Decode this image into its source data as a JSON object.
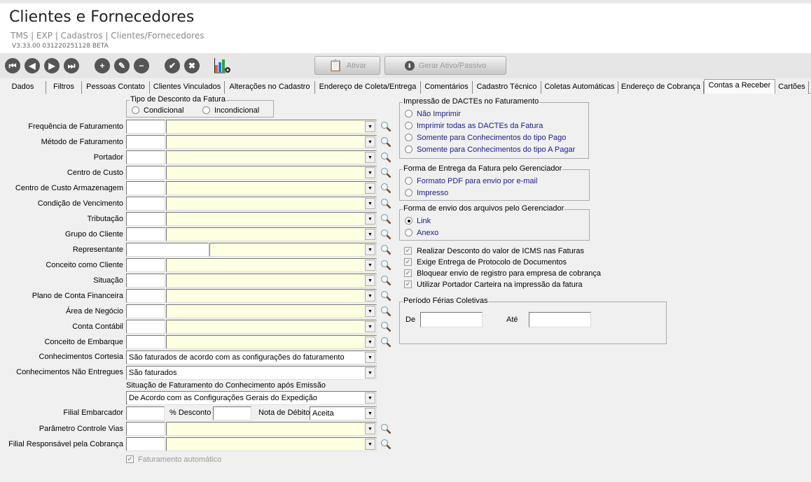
{
  "header": {
    "title": "Clientes e Fornecedores",
    "breadcrumb": "TMS | EXP | Cadastros | Clientes/Fornecedores",
    "version": "V3.33.00 031220251128 BETA"
  },
  "toolbar": {
    "icons": [
      "first-icon",
      "previous-icon",
      "next-icon",
      "last-icon",
      "add-icon",
      "edit-icon",
      "remove-icon",
      "confirm-icon",
      "cancel-icon",
      "chart-settings-icon"
    ],
    "ativar": "Ativar",
    "gerar": "Gerar Ativo/Passivo"
  },
  "tabs": [
    "Dados",
    "Filtros",
    "Pessoas Contato",
    "Clientes Vinculados",
    "Alterações no Cadastro",
    "Endereço de Coleta/Entrega",
    "Comentários",
    "Cadastro Técnico",
    "Coletas Automáticas",
    "Endereço de Cobrança",
    "Contas a Receber",
    "Cartões"
  ],
  "active_tab": "Contas a Receber",
  "desconto": {
    "legend": "Tipo de Desconto da Fatura",
    "options": [
      "Condicional",
      "Incondicional"
    ]
  },
  "lookups": [
    "Frequência de Faturamento",
    "Método de Faturamento",
    "Portador",
    "Centro de Custo",
    "Centro de Custo Armazenagem",
    "Condição de Vencimento",
    "Tributação",
    "Grupo do Cliente",
    "Representante",
    "Conceito como Cliente",
    "Situação",
    "Plano de Conta Financeira",
    "Área de Negócio",
    "Conta Contábil",
    "Conceito de Embarque"
  ],
  "cortesia": {
    "label": "Conhecimentos Cortesia",
    "value": "São faturados de acordo com as configurações do faturamento"
  },
  "nao_entregues": {
    "label": "Conhecimentos Não Entregues",
    "value": "São faturados"
  },
  "situacao": {
    "label": "Situação de Faturamento do Conhecimento após Emissão",
    "value": "De Acordo com as Configurações Gerais do Expedição"
  },
  "filial_embarcador": {
    "label": "Filial Embarcador",
    "desconto_label": "% Desconto",
    "nota_label": "Nota de Débito",
    "nota_value": "Aceita"
  },
  "parametro": "Parâmetro Controle Vias",
  "filial_cobranca": "Filial Responsável pela Cobrança",
  "faturamento_auto": {
    "label": "Faturamento automático",
    "checked": true
  },
  "impressao": {
    "legend": "Impressão de DACTEs no Faturamento",
    "options": [
      "Não Imprimir",
      "Imprimir todas as DACTEs da Fatura",
      "Somente para Conhecimentos do tipo Pago",
      "Somente para Conhecimentos do tipo A Pagar"
    ]
  },
  "entrega": {
    "legend": "Forma de Entrega da Fatura pelo Gerenciador",
    "options": [
      "Formato PDF para envio por e-mail",
      "Impresso"
    ]
  },
  "envio": {
    "legend": "Forma de envio dos arquivos pelo Gerenciador",
    "options": [
      "Link",
      "Anexo"
    ],
    "selected": "Link"
  },
  "checks": [
    {
      "label": "Realizar Desconto do valor de ICMS nas Faturas",
      "checked": true
    },
    {
      "label": "Exige Entrega de Protocolo de Documentos",
      "checked": true
    },
    {
      "label": "Bloquear envio de registro para empresa de cobrança",
      "checked": true
    },
    {
      "label": "Utilizar Portador Carteira na impressão da fatura",
      "checked": true
    }
  ],
  "ferias": {
    "legend": "Período Férias Coletivas",
    "de": "De",
    "ate": "Até"
  }
}
